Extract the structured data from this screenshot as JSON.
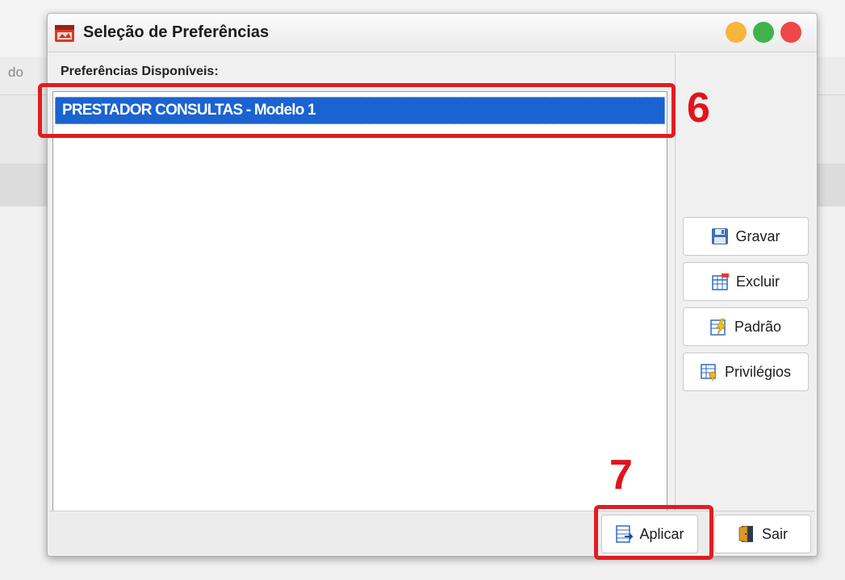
{
  "background": {
    "partial_label": "do"
  },
  "dialog": {
    "title": "Seleção de Preferências",
    "app_icon": "app-logo-icon",
    "window_controls": [
      "minimize",
      "maximize",
      "close"
    ],
    "list_label": "Preferências Disponíveis:",
    "list_items": [
      {
        "label": "PRESTADOR CONSULTAS - Modelo 1",
        "selected": true
      }
    ],
    "side_buttons": [
      {
        "label": "Gravar",
        "icon": "save-disk-icon"
      },
      {
        "label": "Excluir",
        "icon": "delete-table-icon"
      },
      {
        "label": "Padrão",
        "icon": "default-lightning-icon"
      },
      {
        "label": "Privilégios",
        "icon": "privileges-key-icon"
      }
    ],
    "bottom_buttons": {
      "apply": {
        "label": "Aplicar",
        "icon": "apply-icon"
      },
      "exit": {
        "label": "Sair",
        "icon": "exit-door-icon"
      }
    }
  },
  "annotations": {
    "callout_6": "6",
    "callout_7": "7"
  },
  "colors": {
    "selection": "#1a63d1",
    "callout_red": "#e21c23",
    "win_minimize": "#f6b63a",
    "win_maximize": "#3fb44b",
    "win_close": "#ee4848"
  }
}
